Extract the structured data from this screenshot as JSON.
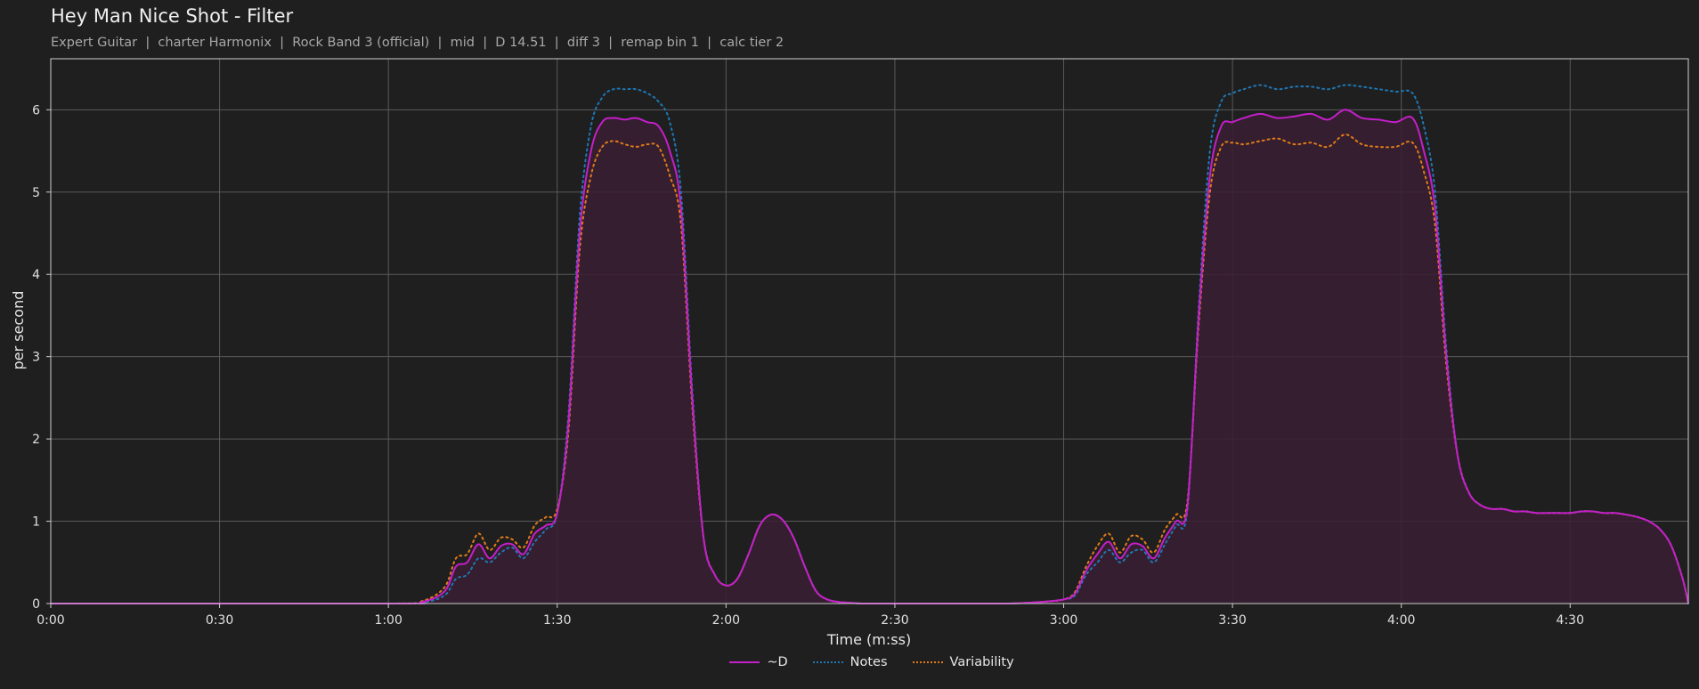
{
  "header": {
    "title": "Hey Man Nice Shot - Filter",
    "subtitle": "Expert Guitar  |  charter Harmonix  |  Rock Band 3 (official)  |  mid  |  D 14.51  |  diff 3  |  remap bin 1  |  calc tier 2"
  },
  "colors": {
    "background": "#1f1f1f",
    "d_line": "#c41fc9",
    "notes_line": "#1f77b4",
    "variability_line": "#e07b1a",
    "fill": "#3a1f33"
  },
  "chart_data": {
    "type": "line",
    "title": "Hey Man Nice Shot - Filter",
    "xlabel": "Time (m:ss)",
    "ylabel": "per second",
    "xlim": [
      0,
      291
    ],
    "ylim": [
      0,
      6.62
    ],
    "x_ticks": [
      0,
      30,
      60,
      90,
      120,
      150,
      180,
      210,
      240,
      270
    ],
    "x_tick_labels": [
      "0:00",
      "0:30",
      "1:00",
      "1:30",
      "2:00",
      "2:30",
      "3:00",
      "3:30",
      "4:00",
      "4:30"
    ],
    "y_ticks": [
      0,
      1,
      2,
      3,
      4,
      5,
      6
    ],
    "y_tick_labels": [
      "0",
      "1",
      "2",
      "3",
      "4",
      "5",
      "6"
    ],
    "grid": true,
    "legend_position": "bottom-center",
    "x": [
      0,
      60,
      66,
      70,
      72,
      74,
      76,
      78,
      80,
      82,
      84,
      86,
      88,
      90,
      92,
      94,
      96,
      98,
      100,
      102,
      104,
      106,
      108,
      110,
      112,
      114,
      116,
      118,
      120,
      122,
      124,
      126,
      128,
      130,
      132,
      134,
      136,
      138,
      140,
      142,
      144,
      146,
      150,
      160,
      170,
      176,
      180,
      182,
      184,
      186,
      188,
      190,
      192,
      194,
      196,
      198,
      200,
      202,
      204,
      206,
      208,
      210,
      212,
      215,
      218,
      221,
      224,
      227,
      230,
      233,
      236,
      239,
      242,
      244,
      246,
      248,
      250,
      252,
      254,
      256,
      258,
      260,
      262,
      264,
      266,
      268,
      270,
      272,
      274,
      276,
      278,
      280,
      282,
      284,
      286,
      288,
      290,
      291
    ],
    "series": [
      {
        "name": "~D",
        "style": "solid",
        "values": [
          0,
          0,
          0.02,
          0.15,
          0.45,
          0.5,
          0.72,
          0.55,
          0.7,
          0.72,
          0.6,
          0.85,
          0.95,
          1.1,
          2.2,
          4.5,
          5.5,
          5.85,
          5.9,
          5.88,
          5.9,
          5.85,
          5.8,
          5.5,
          4.8,
          2.5,
          0.8,
          0.35,
          0.22,
          0.3,
          0.6,
          0.95,
          1.08,
          1.02,
          0.8,
          0.45,
          0.15,
          0.05,
          0.02,
          0.01,
          0,
          0,
          0,
          0,
          0,
          0.02,
          0.05,
          0.12,
          0.4,
          0.6,
          0.75,
          0.55,
          0.72,
          0.7,
          0.55,
          0.8,
          1.0,
          1.2,
          3.5,
          5.2,
          5.8,
          5.85,
          5.9,
          5.95,
          5.9,
          5.92,
          5.95,
          5.88,
          6.0,
          5.9,
          5.88,
          5.85,
          5.9,
          5.5,
          4.8,
          3.0,
          1.8,
          1.35,
          1.2,
          1.15,
          1.15,
          1.12,
          1.12,
          1.1,
          1.1,
          1.1,
          1.1,
          1.12,
          1.12,
          1.1,
          1.1,
          1.08,
          1.05,
          1.0,
          0.9,
          0.7,
          0.3,
          0
        ]
      },
      {
        "name": "Notes",
        "style": "dotted",
        "values": [
          0,
          0,
          0.01,
          0.1,
          0.3,
          0.35,
          0.55,
          0.5,
          0.62,
          0.68,
          0.55,
          0.75,
          0.9,
          1.1,
          2.3,
          4.7,
          5.8,
          6.15,
          6.25,
          6.25,
          6.25,
          6.2,
          6.1,
          5.85,
          5.0,
          2.6,
          0.8,
          0.35,
          0.22,
          0.3,
          0.6,
          0.95,
          1.08,
          1.02,
          0.8,
          0.45,
          0.15,
          0.05,
          0.02,
          0.01,
          0,
          0,
          0,
          0,
          0,
          0.02,
          0.05,
          0.1,
          0.35,
          0.5,
          0.65,
          0.5,
          0.62,
          0.65,
          0.5,
          0.72,
          0.95,
          1.15,
          3.6,
          5.5,
          6.1,
          6.2,
          6.25,
          6.3,
          6.25,
          6.28,
          6.28,
          6.25,
          6.3,
          6.28,
          6.25,
          6.22,
          6.2,
          5.8,
          5.0,
          3.1,
          1.8,
          1.35,
          1.2,
          1.15,
          1.15,
          1.12,
          1.12,
          1.1,
          1.1,
          1.1,
          1.1,
          1.12,
          1.12,
          1.1,
          1.1,
          1.08,
          1.05,
          1.0,
          0.9,
          0.7,
          0.3,
          0
        ]
      },
      {
        "name": "Variability",
        "style": "dotted",
        "values": [
          0,
          0,
          0.03,
          0.2,
          0.55,
          0.6,
          0.85,
          0.65,
          0.8,
          0.78,
          0.68,
          0.95,
          1.05,
          1.15,
          2.1,
          4.3,
          5.2,
          5.55,
          5.62,
          5.58,
          5.55,
          5.58,
          5.55,
          5.2,
          4.6,
          2.4,
          0.8,
          0.35,
          0.22,
          0.3,
          0.6,
          0.95,
          1.08,
          1.02,
          0.8,
          0.45,
          0.15,
          0.05,
          0.02,
          0.01,
          0,
          0,
          0,
          0,
          0,
          0.02,
          0.05,
          0.14,
          0.45,
          0.7,
          0.85,
          0.62,
          0.82,
          0.78,
          0.62,
          0.9,
          1.08,
          1.25,
          3.4,
          5.0,
          5.55,
          5.6,
          5.58,
          5.62,
          5.65,
          5.58,
          5.6,
          5.55,
          5.7,
          5.58,
          5.55,
          5.55,
          5.6,
          5.25,
          4.6,
          2.9,
          1.8,
          1.35,
          1.2,
          1.15,
          1.15,
          1.12,
          1.12,
          1.1,
          1.1,
          1.1,
          1.1,
          1.12,
          1.12,
          1.1,
          1.1,
          1.08,
          1.05,
          1.0,
          0.9,
          0.7,
          0.3,
          0
        ]
      }
    ]
  }
}
